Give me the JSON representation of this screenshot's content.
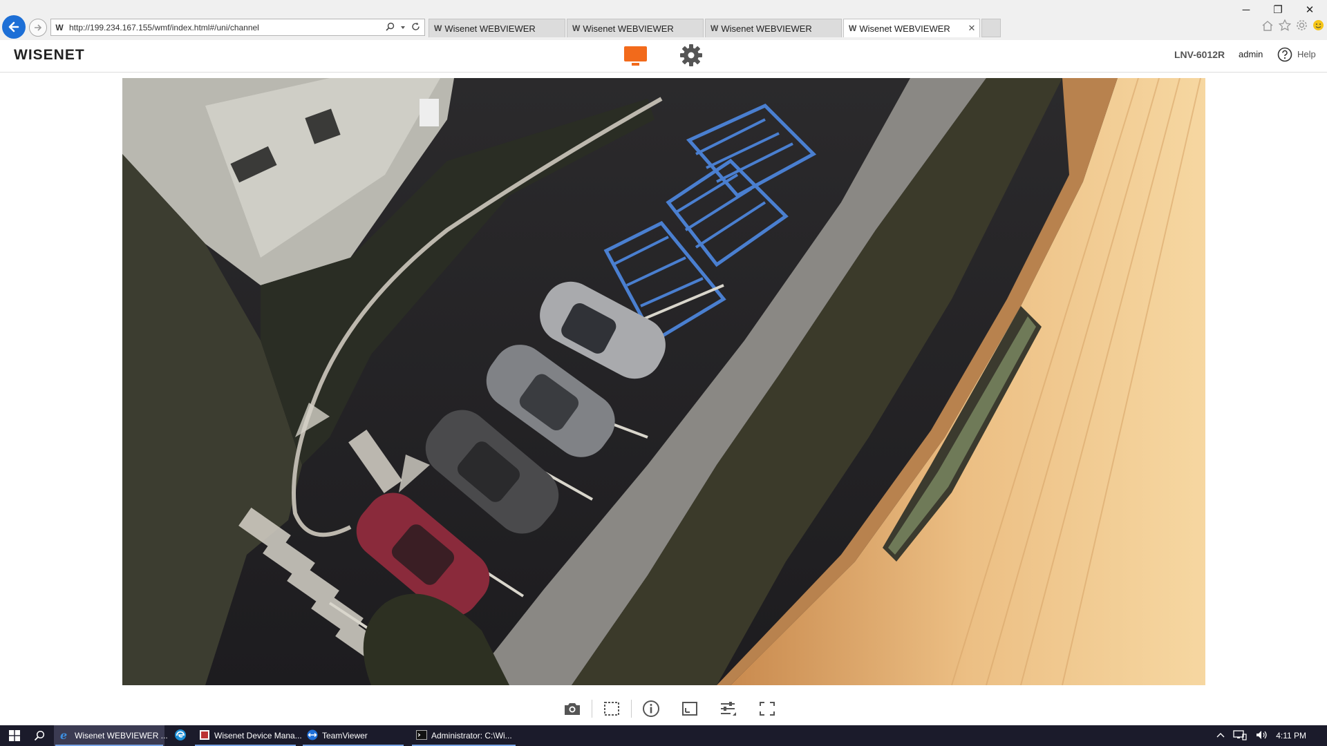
{
  "browser": {
    "url": "http://199.234.167.155/wmf/index.html#/uni/channel",
    "favicon_letter": "W",
    "tabs": [
      {
        "title": "Wisenet WEBVIEWER",
        "active": false
      },
      {
        "title": "Wisenet WEBVIEWER",
        "active": false
      },
      {
        "title": "Wisenet WEBVIEWER",
        "active": false
      },
      {
        "title": "Wisenet WEBVIEWER",
        "active": true
      }
    ],
    "tab_close": "✕",
    "window_controls": {
      "minimize": "─",
      "restore": "❐",
      "close": "✕"
    },
    "icons": [
      "back-arrow-icon",
      "forward-arrow-icon",
      "search-icon",
      "refresh-icon",
      "home-icon",
      "favorites-star-icon",
      "settings-gear-icon",
      "smiley-feedback-icon"
    ]
  },
  "header": {
    "logo": "WISENET",
    "live_icon": "monitor-live-icon",
    "setup_icon": "gear-setup-icon",
    "model": "LNV-6012R",
    "user": "admin",
    "help_label": "Help",
    "accent_color": "#f26a1b"
  },
  "video": {
    "scene": "overhead camera view of a parking lot with handicap spaces, four parked cars, sidewalk and a building wall"
  },
  "video_toolbar": {
    "buttons": [
      "camera-snapshot-icon",
      "area-zoom-icon",
      "info-icon",
      "aspect-ratio-icon",
      "adjust-settings-icon",
      "fullscreen-icon"
    ]
  },
  "taskbar": {
    "apps": [
      {
        "label": "Wisenet WEBVIEWER ...",
        "icon": "ie-icon",
        "active": true
      },
      {
        "label": "",
        "icon": "edge-icon",
        "active": false
      },
      {
        "label": "Wisenet Device Mana...",
        "icon": "wisenet-dm-icon",
        "active": false
      },
      {
        "label": "TeamViewer",
        "icon": "teamviewer-icon",
        "active": false
      },
      {
        "label": "Administrator: C:\\Wi...",
        "icon": "cmd-icon",
        "active": false
      }
    ],
    "time": "4:11 PM"
  }
}
